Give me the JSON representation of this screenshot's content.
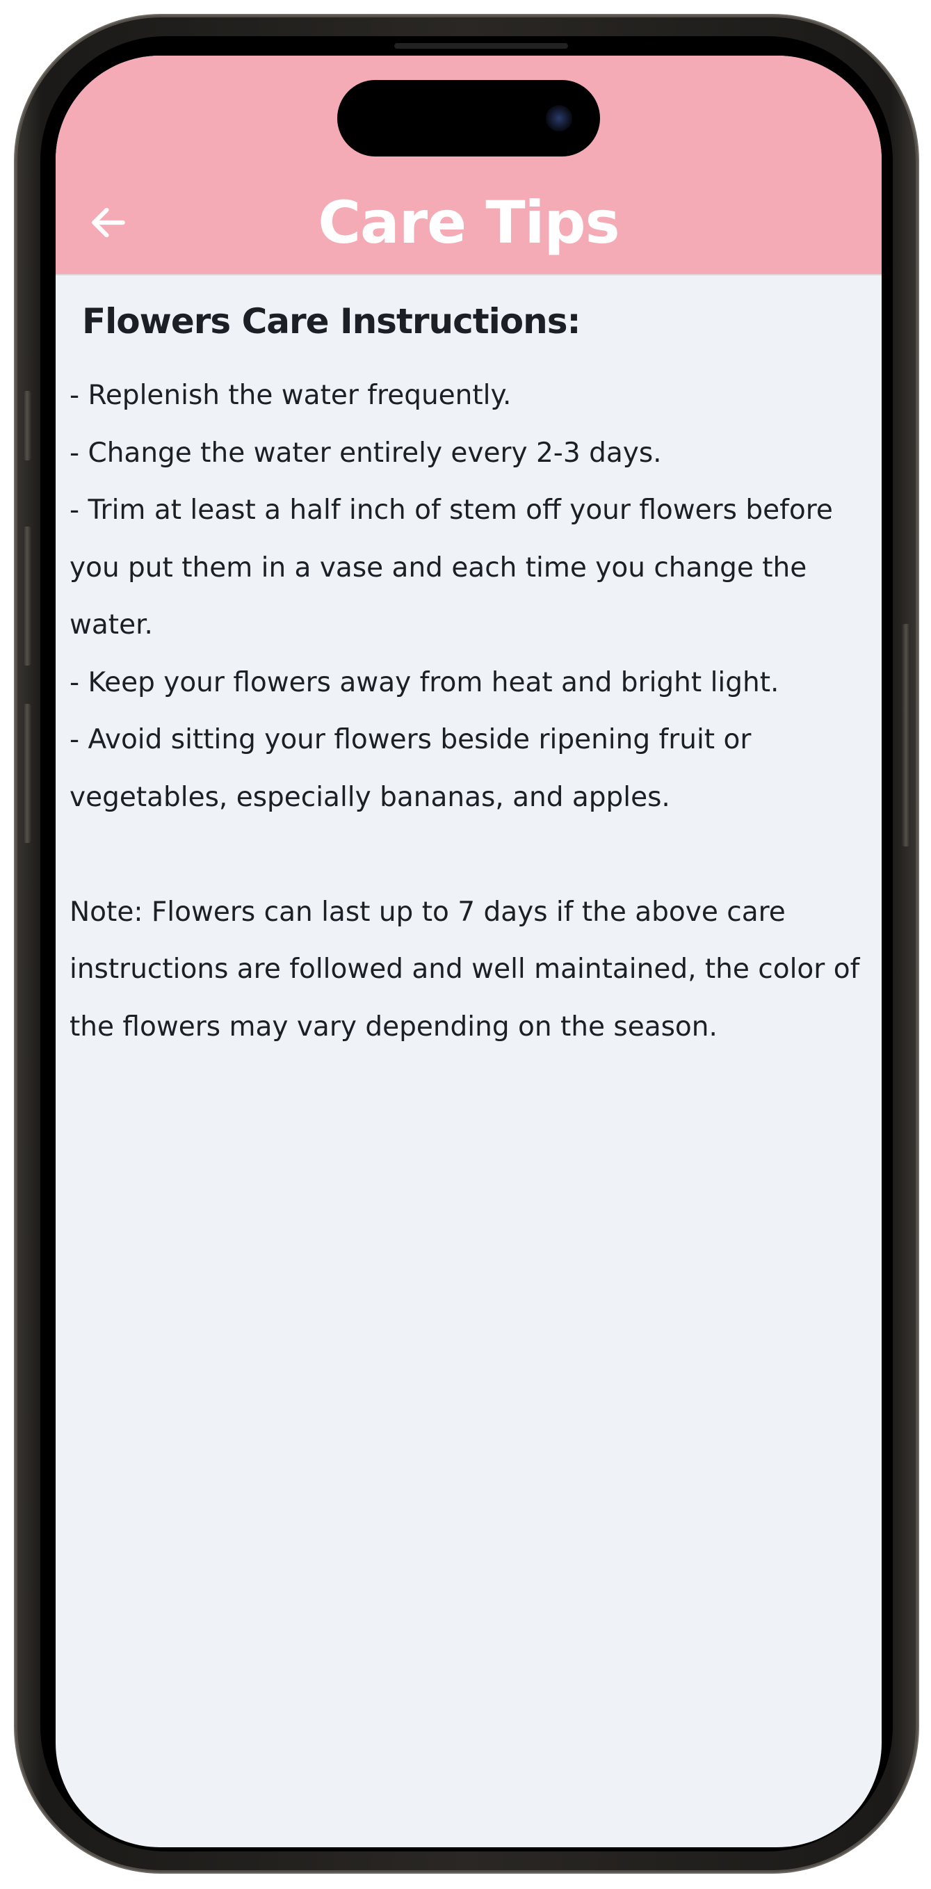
{
  "header": {
    "title": "Care Tips",
    "background_color": "#f4abb5",
    "back_icon": "arrow-left-icon"
  },
  "content": {
    "section_title": "Flowers Care Instructions:",
    "instructions": [
      "- Replenish the water frequently.",
      "- Change the water entirely every 2-3 days.",
      "- Trim at least a half inch of stem off your flowers before you put them in a vase and each time you change the water.",
      "- Keep your flowers away from heat and bright light.",
      "- Avoid sitting your flowers beside ripening fruit or vegetables, especially bananas, and apples."
    ],
    "note": "Note: Flowers can last up to 7 days if the above care instructions are followed and well maintained, the color of the flowers may vary depending on the season."
  }
}
